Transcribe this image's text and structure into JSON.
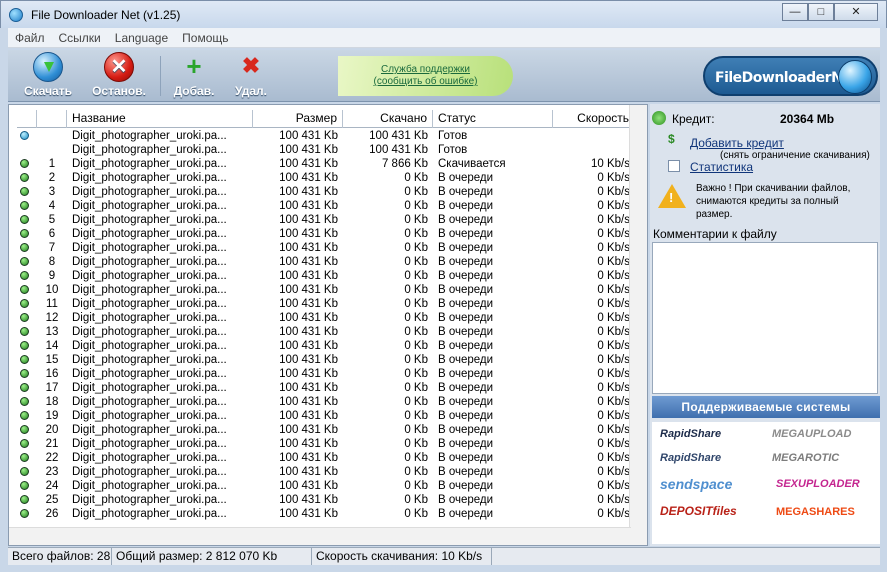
{
  "window": {
    "title": "File Downloader Net (v1.25)",
    "min": "—",
    "max": "□",
    "close": "✕"
  },
  "menu": [
    "Файл",
    "Ссылки",
    "Language",
    "Помощь"
  ],
  "toolbar": {
    "download": "Скачать",
    "stop": "Останов.",
    "add": "Добав.",
    "remove": "Удал.",
    "support_line1": "Служба поддержки",
    "support_line2": "(сообщить об ошибке)",
    "brand": "FileDownloaderNet"
  },
  "list": {
    "headers": {
      "name": "Название",
      "size": "Размер",
      "downloaded": "Скачано",
      "status": "Статус",
      "speed": "Скорость"
    },
    "rows": [
      {
        "dot": "blue",
        "num": "",
        "name": "Digit_photographer_uroki.pa...",
        "size": "100 431 Kb",
        "down": "100 431 Kb",
        "status": "Готов",
        "speed": ""
      },
      {
        "dot": "",
        "num": "",
        "name": "Digit_photographer_uroki.pa...",
        "size": "100 431 Kb",
        "down": "100 431 Kb",
        "status": "Готов",
        "speed": ""
      },
      {
        "dot": "green",
        "num": "1",
        "name": "Digit_photographer_uroki.pa...",
        "size": "100 431 Kb",
        "down": "7 866 Kb",
        "status": "Скачивается",
        "speed": "10 Kb/s"
      },
      {
        "dot": "green",
        "num": "2",
        "name": "Digit_photographer_uroki.pa...",
        "size": "100 431 Kb",
        "down": "0 Kb",
        "status": "В очереди",
        "speed": "0 Kb/s"
      },
      {
        "dot": "green",
        "num": "3",
        "name": "Digit_photographer_uroki.pa...",
        "size": "100 431 Kb",
        "down": "0 Kb",
        "status": "В очереди",
        "speed": "0 Kb/s"
      },
      {
        "dot": "green",
        "num": "4",
        "name": "Digit_photographer_uroki.pa...",
        "size": "100 431 Kb",
        "down": "0 Kb",
        "status": "В очереди",
        "speed": "0 Kb/s"
      },
      {
        "dot": "green",
        "num": "5",
        "name": "Digit_photographer_uroki.pa...",
        "size": "100 431 Kb",
        "down": "0 Kb",
        "status": "В очереди",
        "speed": "0 Kb/s"
      },
      {
        "dot": "green",
        "num": "6",
        "name": "Digit_photographer_uroki.pa...",
        "size": "100 431 Kb",
        "down": "0 Kb",
        "status": "В очереди",
        "speed": "0 Kb/s"
      },
      {
        "dot": "green",
        "num": "7",
        "name": "Digit_photographer_uroki.pa...",
        "size": "100 431 Kb",
        "down": "0 Kb",
        "status": "В очереди",
        "speed": "0 Kb/s"
      },
      {
        "dot": "green",
        "num": "8",
        "name": "Digit_photographer_uroki.pa...",
        "size": "100 431 Kb",
        "down": "0 Kb",
        "status": "В очереди",
        "speed": "0 Kb/s"
      },
      {
        "dot": "green",
        "num": "9",
        "name": "Digit_photographer_uroki.pa...",
        "size": "100 431 Kb",
        "down": "0 Kb",
        "status": "В очереди",
        "speed": "0 Kb/s"
      },
      {
        "dot": "green",
        "num": "10",
        "name": "Digit_photographer_uroki.pa...",
        "size": "100 431 Kb",
        "down": "0 Kb",
        "status": "В очереди",
        "speed": "0 Kb/s"
      },
      {
        "dot": "green",
        "num": "11",
        "name": "Digit_photographer_uroki.pa...",
        "size": "100 431 Kb",
        "down": "0 Kb",
        "status": "В очереди",
        "speed": "0 Kb/s"
      },
      {
        "dot": "green",
        "num": "12",
        "name": "Digit_photographer_uroki.pa...",
        "size": "100 431 Kb",
        "down": "0 Kb",
        "status": "В очереди",
        "speed": "0 Kb/s"
      },
      {
        "dot": "green",
        "num": "13",
        "name": "Digit_photographer_uroki.pa...",
        "size": "100 431 Kb",
        "down": "0 Kb",
        "status": "В очереди",
        "speed": "0 Kb/s"
      },
      {
        "dot": "green",
        "num": "14",
        "name": "Digit_photographer_uroki.pa...",
        "size": "100 431 Kb",
        "down": "0 Kb",
        "status": "В очереди",
        "speed": "0 Kb/s"
      },
      {
        "dot": "green",
        "num": "15",
        "name": "Digit_photographer_uroki.pa...",
        "size": "100 431 Kb",
        "down": "0 Kb",
        "status": "В очереди",
        "speed": "0 Kb/s"
      },
      {
        "dot": "green",
        "num": "16",
        "name": "Digit_photographer_uroki.pa...",
        "size": "100 431 Kb",
        "down": "0 Kb",
        "status": "В очереди",
        "speed": "0 Kb/s"
      },
      {
        "dot": "green",
        "num": "17",
        "name": "Digit_photographer_uroki.pa...",
        "size": "100 431 Kb",
        "down": "0 Kb",
        "status": "В очереди",
        "speed": "0 Kb/s"
      },
      {
        "dot": "green",
        "num": "18",
        "name": "Digit_photographer_uroki.pa...",
        "size": "100 431 Kb",
        "down": "0 Kb",
        "status": "В очереди",
        "speed": "0 Kb/s"
      },
      {
        "dot": "green",
        "num": "19",
        "name": "Digit_photographer_uroki.pa...",
        "size": "100 431 Kb",
        "down": "0 Kb",
        "status": "В очереди",
        "speed": "0 Kb/s"
      },
      {
        "dot": "green",
        "num": "20",
        "name": "Digit_photographer_uroki.pa...",
        "size": "100 431 Kb",
        "down": "0 Kb",
        "status": "В очереди",
        "speed": "0 Kb/s"
      },
      {
        "dot": "green",
        "num": "21",
        "name": "Digit_photographer_uroki.pa...",
        "size": "100 431 Kb",
        "down": "0 Kb",
        "status": "В очереди",
        "speed": "0 Kb/s"
      },
      {
        "dot": "green",
        "num": "22",
        "name": "Digit_photographer_uroki.pa...",
        "size": "100 431 Kb",
        "down": "0 Kb",
        "status": "В очереди",
        "speed": "0 Kb/s"
      },
      {
        "dot": "green",
        "num": "23",
        "name": "Digit_photographer_uroki.pa...",
        "size": "100 431 Kb",
        "down": "0 Kb",
        "status": "В очереди",
        "speed": "0 Kb/s"
      },
      {
        "dot": "green",
        "num": "24",
        "name": "Digit_photographer_uroki.pa...",
        "size": "100 431 Kb",
        "down": "0 Kb",
        "status": "В очереди",
        "speed": "0 Kb/s"
      },
      {
        "dot": "green",
        "num": "25",
        "name": "Digit_photographer_uroki.pa...",
        "size": "100 431 Kb",
        "down": "0 Kb",
        "status": "В очереди",
        "speed": "0 Kb/s"
      },
      {
        "dot": "green",
        "num": "26",
        "name": "Digit_photographer_uroki.pa...",
        "size": "100 431 Kb",
        "down": "0 Kb",
        "status": "В очереди",
        "speed": "0 Kb/s"
      }
    ]
  },
  "panel": {
    "credit_label": "Кредит:",
    "credit_value": "20364 Mb",
    "add_credit": "Добавить кредит",
    "add_credit_note": "(снять ограничение скачивания)",
    "stats": "Статистика",
    "warning": "Важно ! При скачивании файлов, снимаются кредиты за полный размер.",
    "comments_label": "Комментарии к файлу",
    "supported": "Поддерживаемые системы",
    "logos": [
      "RapidShare",
      "MEGAUPLOAD",
      "RapidShare",
      "MEGAROTIC",
      "sendspace",
      "SEXUPLOADER",
      "DEPOSITfiles",
      "MEGASHARES"
    ]
  },
  "status": {
    "total_files": "Всего файлов: 28",
    "total_size": "Общий размер: 2 812 070 Kb",
    "speed": "Скорость скачивания: 10 Kb/s"
  }
}
